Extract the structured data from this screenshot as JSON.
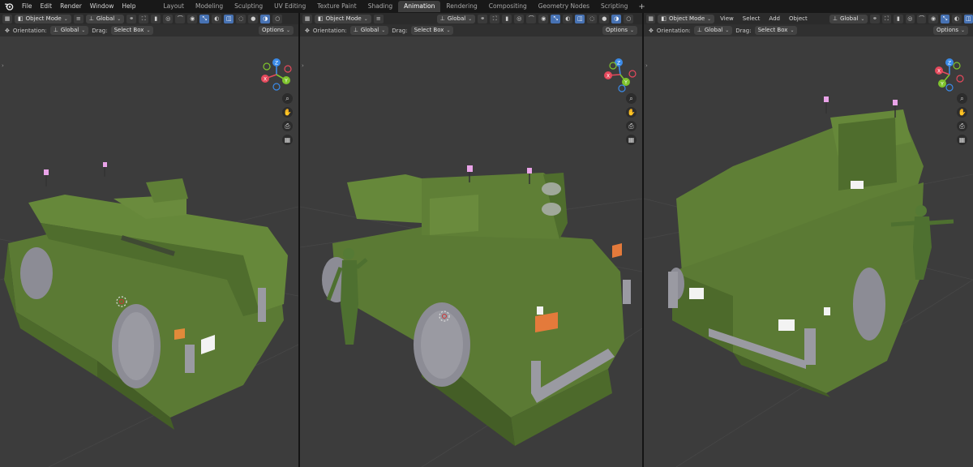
{
  "topbar": {
    "menu": [
      "File",
      "Edit",
      "Render",
      "Window",
      "Help"
    ],
    "workspaces": [
      "Layout",
      "Modeling",
      "Sculpting",
      "UV Editing",
      "Texture Paint",
      "Shading",
      "Animation",
      "Rendering",
      "Compositing",
      "Geometry Nodes",
      "Scripting"
    ],
    "active_workspace": "Animation",
    "add_tab": "+"
  },
  "editors": [
    {
      "mode": "Object Mode",
      "transform_orientation": "Global",
      "extra_menus": [],
      "orientation_label": "Orientation:",
      "orientation_value": "Global",
      "drag_label": "Drag:",
      "drag_value": "Select Box",
      "options_label": "Options"
    },
    {
      "mode": "Object Mode",
      "transform_orientation": "Global",
      "extra_menus": [],
      "orientation_label": "Orientation:",
      "orientation_value": "Global",
      "drag_label": "Drag:",
      "drag_value": "Select Box",
      "options_label": "Options"
    },
    {
      "mode": "Object Mode",
      "transform_orientation": "Global",
      "extra_menus": [
        "View",
        "Select",
        "Add",
        "Object"
      ],
      "orientation_label": "Orientation:",
      "orientation_value": "Global",
      "drag_label": "Drag:",
      "drag_value": "Select Box",
      "options_label": "Options"
    }
  ],
  "gizmo_axes": {
    "x": "X",
    "y": "Y",
    "z": "Z"
  },
  "colors": {
    "axis_x": "#e5495c",
    "axis_y": "#7fc42d",
    "axis_z": "#3b8be8",
    "vehicle_body": "#5b7a34",
    "vehicle_shadow": "#445e26",
    "wheel": "#8c8c95",
    "light_marker": "#e9a3e8",
    "active_blue": "#4772b3"
  }
}
